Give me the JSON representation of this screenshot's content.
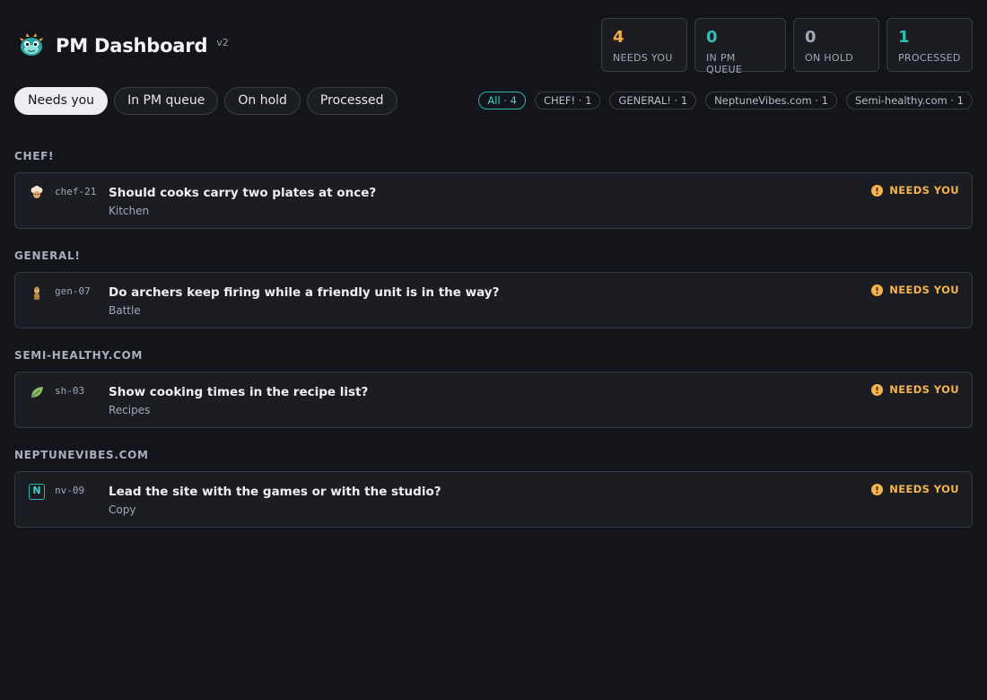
{
  "header": {
    "title": "PM Dashboard",
    "version": "v2",
    "logo_icon": "teal-creature-logo"
  },
  "stats": [
    {
      "value": "4",
      "label": "NEEDS YOU",
      "color": "#f2b04d"
    },
    {
      "value": "0",
      "label": "IN PM QUEUE",
      "color": "#2fc1b5"
    },
    {
      "value": "0",
      "label": "ON HOLD",
      "color": "#a3a8b2"
    },
    {
      "value": "1",
      "label": "PROCESSED",
      "color": "#2fc1b5"
    }
  ],
  "tabs": [
    {
      "label": "Needs you",
      "active": true
    },
    {
      "label": "In PM queue",
      "active": false
    },
    {
      "label": "On hold",
      "active": false
    },
    {
      "label": "Processed",
      "active": false
    }
  ],
  "filters": [
    {
      "label": "All · 4",
      "active": true
    },
    {
      "label": "CHEF! · 1",
      "active": false
    },
    {
      "label": "GENERAL! · 1",
      "active": false
    },
    {
      "label": "NeptuneVibes.com · 1",
      "active": false
    },
    {
      "label": "Semi-healthy.com · 1",
      "active": false
    }
  ],
  "sections": [
    {
      "label": "CHEF!",
      "item": {
        "icon": "chef-hat-icon",
        "code": "chef-21",
        "question": "Should cooks carry two plates at once?",
        "area": "Kitchen",
        "status": "NEEDS YOU"
      }
    },
    {
      "label": "GENERAL!",
      "item": {
        "icon": "soldier-icon",
        "code": "gen-07",
        "question": "Do archers keep firing while a friendly unit is in the way?",
        "area": "Battle",
        "status": "NEEDS YOU"
      }
    },
    {
      "label": "SEMI-HEALTHY.COM",
      "item": {
        "icon": "leaf-icon",
        "code": "sh-03",
        "question": "Show cooking times in the recipe list?",
        "area": "Recipes",
        "status": "NEEDS YOU"
      }
    },
    {
      "label": "NEPTUNEVIBES.COM",
      "item": {
        "icon": "n-letter-icon",
        "code": "nv-09",
        "question": "Lead the site with the games or with the studio?",
        "area": "Copy",
        "status": "NEEDS YOU",
        "icon_letter": "N"
      }
    }
  ],
  "colors": {
    "background": "#14151a",
    "card": "#1b1d23",
    "accent_teal": "#2ab7b0",
    "warning": "#f5b34d"
  }
}
